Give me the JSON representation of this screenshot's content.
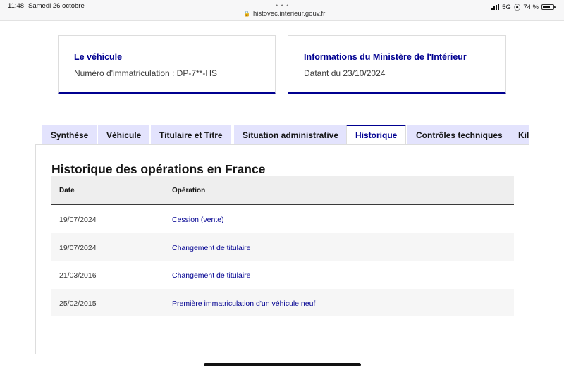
{
  "status_bar": {
    "time": "11:48",
    "date": "Samedi 26 octobre",
    "url": "histovec.interieur.gouv.fr",
    "network": "5G",
    "battery": "74 %",
    "battery_level": 0.74
  },
  "cards": {
    "vehicle": {
      "title": "Le véhicule",
      "text": "Numéro d'immatriculation : DP-7**-HS"
    },
    "ministry": {
      "title": "Informations du Ministère de l'Intérieur",
      "text": "Datant du 23/10/2024"
    }
  },
  "tabs": [
    {
      "label": "Synthèse",
      "active": false
    },
    {
      "label": "Véhicule",
      "active": false
    },
    {
      "label": "Titulaire et Titre",
      "active": false
    },
    {
      "label": "Situation administrative",
      "active": false
    },
    {
      "label": "Historique",
      "active": true
    },
    {
      "label": "Contrôles techniques",
      "active": false
    },
    {
      "label": "Kilo",
      "active": false
    }
  ],
  "history": {
    "title": "Historique des opérations en France",
    "columns": {
      "date": "Date",
      "operation": "Opération"
    },
    "rows": [
      {
        "date": "19/07/2024",
        "operation": "Cession (vente)"
      },
      {
        "date": "19/07/2024",
        "operation": "Changement de titulaire"
      },
      {
        "date": "21/03/2016",
        "operation": "Changement de titulaire"
      },
      {
        "date": "25/02/2015",
        "operation": "Première immatriculation d'un véhicule neuf"
      }
    ]
  },
  "colors": {
    "accent": "#000091",
    "tab_background": "#e3e3fd",
    "row_alt": "#f6f6f6"
  }
}
